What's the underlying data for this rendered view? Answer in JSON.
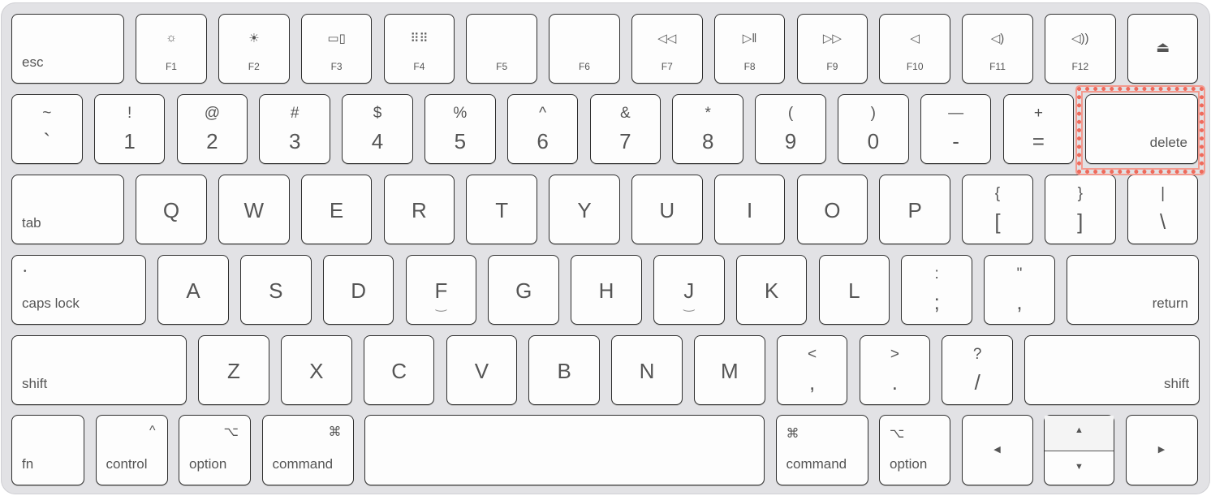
{
  "highlight": {
    "target": "delete",
    "color": "#ef6a5b"
  },
  "rows": [
    [
      {
        "label": "esc",
        "style": "mod-left"
      },
      {
        "label": "F1",
        "icon": "brightness-down-icon"
      },
      {
        "label": "F2",
        "icon": "brightness-up-icon"
      },
      {
        "label": "F3",
        "icon": "mission-control-icon"
      },
      {
        "label": "F4",
        "icon": "launchpad-icon"
      },
      {
        "label": "F5"
      },
      {
        "label": "F6"
      },
      {
        "label": "F7",
        "icon": "rewind-icon"
      },
      {
        "label": "F8",
        "icon": "play-pause-icon"
      },
      {
        "label": "F9",
        "icon": "fast-forward-icon"
      },
      {
        "label": "F10",
        "icon": "mute-icon"
      },
      {
        "label": "F11",
        "icon": "volume-down-icon"
      },
      {
        "label": "F12",
        "icon": "volume-up-icon"
      },
      {
        "label": "",
        "icon": "eject-icon"
      }
    ],
    [
      {
        "top": "~",
        "bot": "`"
      },
      {
        "top": "!",
        "bot": "1"
      },
      {
        "top": "@",
        "bot": "2"
      },
      {
        "top": "#",
        "bot": "3"
      },
      {
        "top": "$",
        "bot": "4"
      },
      {
        "top": "%",
        "bot": "5"
      },
      {
        "top": "^",
        "bot": "6"
      },
      {
        "top": "&",
        "bot": "7"
      },
      {
        "top": "*",
        "bot": "8"
      },
      {
        "top": "(",
        "bot": "9"
      },
      {
        "top": ")",
        "bot": "0"
      },
      {
        "top": "—",
        "bot": "-"
      },
      {
        "top": "+",
        "bot": "="
      },
      {
        "label": "delete",
        "style": "mod-right"
      }
    ],
    [
      {
        "label": "tab",
        "style": "mod-left"
      },
      {
        "label": "Q"
      },
      {
        "label": "W"
      },
      {
        "label": "E"
      },
      {
        "label": "R"
      },
      {
        "label": "T"
      },
      {
        "label": "Y"
      },
      {
        "label": "U"
      },
      {
        "label": "I"
      },
      {
        "label": "O"
      },
      {
        "label": "P"
      },
      {
        "top": "{",
        "bot": "["
      },
      {
        "top": "}",
        "bot": "]"
      },
      {
        "top": "|",
        "bot": "\\"
      }
    ],
    [
      {
        "label": "caps lock",
        "style": "mod-left",
        "indicator": "•"
      },
      {
        "label": "A"
      },
      {
        "label": "S"
      },
      {
        "label": "D"
      },
      {
        "label": "F",
        "bump": true
      },
      {
        "label": "G"
      },
      {
        "label": "H"
      },
      {
        "label": "J",
        "bump": true
      },
      {
        "label": "K"
      },
      {
        "label": "L"
      },
      {
        "top": ":",
        "bot": ";"
      },
      {
        "top": "\"",
        "bot": ","
      },
      {
        "label": "return",
        "style": "mod-right"
      }
    ],
    [
      {
        "label": "shift",
        "style": "mod-left"
      },
      {
        "label": "Z"
      },
      {
        "label": "X"
      },
      {
        "label": "C"
      },
      {
        "label": "V"
      },
      {
        "label": "B"
      },
      {
        "label": "N"
      },
      {
        "label": "M"
      },
      {
        "top": "<",
        "bot": ","
      },
      {
        "top": ">",
        "bot": "."
      },
      {
        "top": "?",
        "bot": "/"
      },
      {
        "label": "shift",
        "style": "mod-right"
      }
    ],
    [
      {
        "label": "fn",
        "style": "mod-left"
      },
      {
        "label": "control",
        "style": "mod-left",
        "symbol": "^",
        "symbol_side": "right"
      },
      {
        "label": "option",
        "style": "mod-left",
        "symbol": "⌥",
        "symbol_side": "right"
      },
      {
        "label": "command",
        "style": "mod-left",
        "symbol": "⌘",
        "symbol_side": "right"
      },
      {
        "label": "",
        "style": "space"
      },
      {
        "label": "command",
        "style": "mod-left",
        "symbol": "⌘",
        "symbol_side": "left"
      },
      {
        "label": "option",
        "style": "mod-left",
        "symbol": "⌥",
        "symbol_side": "left"
      },
      {
        "label": "",
        "arrow": "◀"
      },
      {
        "label": "",
        "arrows": [
          "▲",
          "▼"
        ]
      },
      {
        "label": "",
        "arrow": "▶"
      }
    ]
  ]
}
